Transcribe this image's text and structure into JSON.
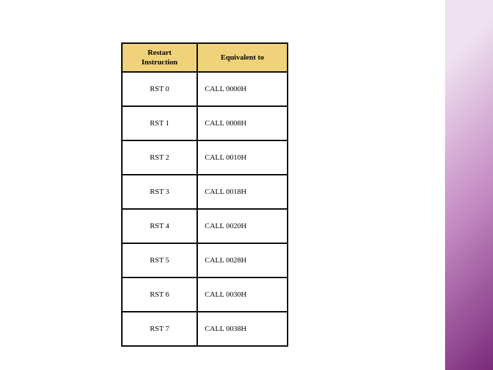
{
  "table": {
    "headers": {
      "instruction": "Restart Instruction",
      "equivalent": "Equivalent to"
    },
    "rows": [
      {
        "instruction": "RST 0",
        "equivalent": "CALL 0000H"
      },
      {
        "instruction": "RST 1",
        "equivalent": "CALL 0008H"
      },
      {
        "instruction": "RST 2",
        "equivalent": "CALL 0010H"
      },
      {
        "instruction": "RST 3",
        "equivalent": "CALL 0018H"
      },
      {
        "instruction": "RST 4",
        "equivalent": "CALL 0020H"
      },
      {
        "instruction": "RST 5",
        "equivalent": "CALL 0028H"
      },
      {
        "instruction": "RST 6",
        "equivalent": "CALL 0030H"
      },
      {
        "instruction": "RST 7",
        "equivalent": "CALL 0038H"
      }
    ]
  }
}
